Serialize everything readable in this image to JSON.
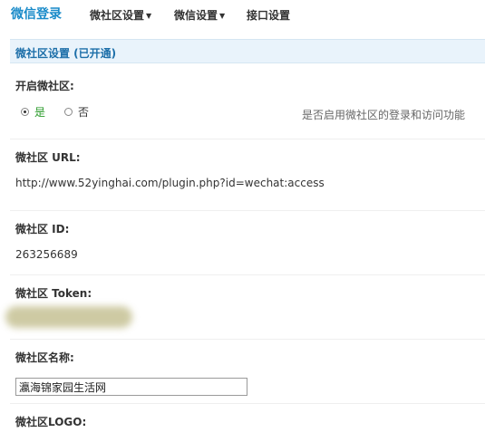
{
  "nav": {
    "brand": "微信登录",
    "menus": [
      {
        "label": "微社区设置",
        "caret": "▼"
      },
      {
        "label": "微信设置",
        "caret": "▼"
      },
      {
        "label": "接口设置",
        "caret": ""
      }
    ]
  },
  "section": {
    "title": "微社区设置 (已开通)"
  },
  "fields": {
    "enable": {
      "label": "开启微社区:",
      "options": [
        {
          "label": "是",
          "checked": true
        },
        {
          "label": "否",
          "checked": false
        }
      ],
      "hint": "是否启用微社区的登录和访问功能"
    },
    "url": {
      "label": "微社区 URL:",
      "value": "http://www.52yinghai.com/plugin.php?id=wechat:access"
    },
    "id": {
      "label": "微社区 ID:",
      "value": "263256689"
    },
    "token": {
      "label": "微社区 Token:"
    },
    "name": {
      "label": "微社区名称:",
      "value": "瀛海锦家园生活网"
    },
    "logo": {
      "label": "微社区LOGO:"
    }
  },
  "colors": {
    "brand": "#1a8bc9",
    "section_bg": "#e9f3fb",
    "section_text": "#1d6fa9",
    "option_selected": "#2a9a2a"
  }
}
